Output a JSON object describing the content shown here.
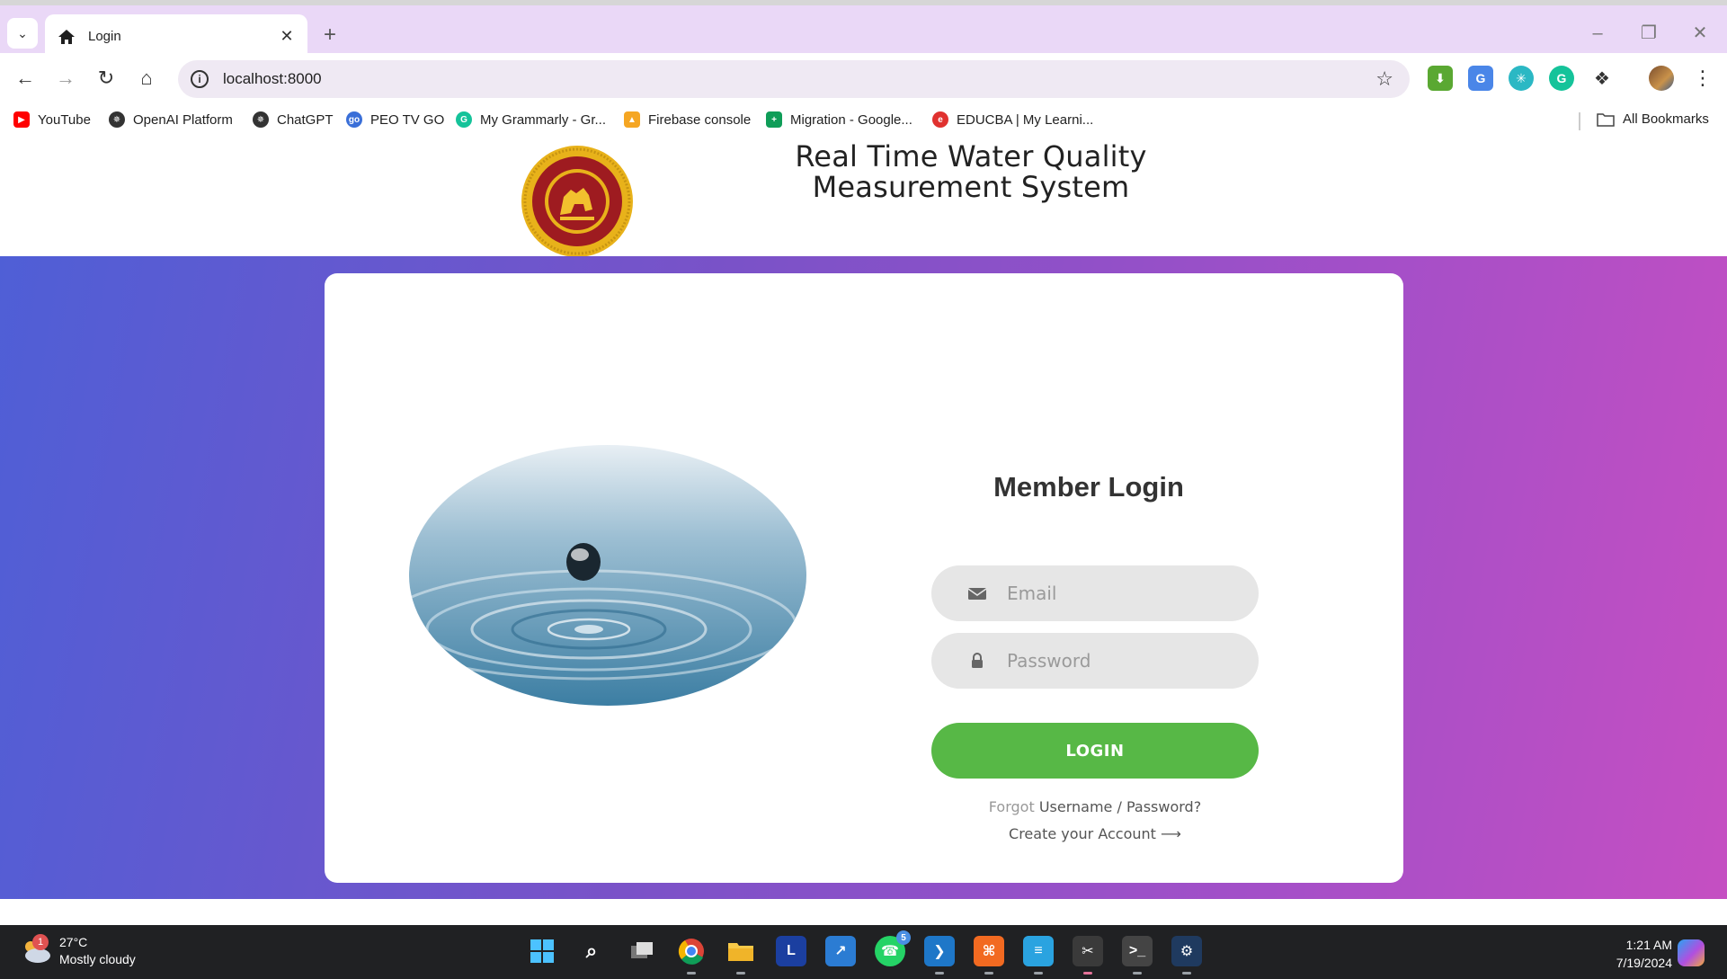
{
  "browser": {
    "tab_title": "Login",
    "url": "localhost:8000",
    "bookmarks": [
      {
        "label": "YouTube",
        "icon": "youtube-icon",
        "color": "#ff0000"
      },
      {
        "label": "OpenAI Platform",
        "icon": "openai-icon",
        "color": "#333333"
      },
      {
        "label": "ChatGPT",
        "icon": "chatgpt-icon",
        "color": "#333333"
      },
      {
        "label": "PEO TV GO",
        "icon": "peotv-icon",
        "color": "#3a6fd8"
      },
      {
        "label": "My Grammarly - Gr...",
        "icon": "grammarly-icon",
        "color": "#15c39a"
      },
      {
        "label": "Firebase console",
        "icon": "firebase-icon",
        "color": "#f5a623"
      },
      {
        "label": "Migration - Google...",
        "icon": "google-sheets-icon",
        "color": "#0f9d58"
      },
      {
        "label": "EDUCBA | My Learni...",
        "icon": "educba-icon",
        "color": "#e0312f"
      }
    ],
    "all_bookmarks": "All Bookmarks"
  },
  "header": {
    "site_title": "Real Time Water Quality Measurement System"
  },
  "login": {
    "title": "Member Login",
    "email_placeholder": "Email",
    "password_placeholder": "Password",
    "button": "LOGIN",
    "forgot_prefix": "Forgot",
    "forgot_link": "Username / Password?",
    "create_account": "Create your Account ⟶"
  },
  "colors": {
    "gradient_left": "#4f5fd6",
    "gradient_right": "#c54fc2",
    "login_button": "#57b846",
    "field_bg": "#e6e6e6"
  },
  "taskbar": {
    "weather_temp": "27°C",
    "weather_desc": "Mostly cloudy",
    "weather_badge": "1",
    "whatsapp_badge": "5",
    "time": "1:21 AM",
    "date": "7/19/2024"
  }
}
